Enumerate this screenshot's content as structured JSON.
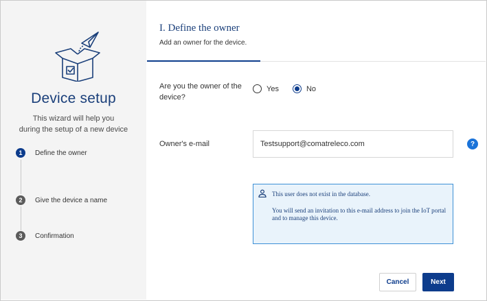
{
  "sidebar": {
    "hero_icon": "open-box-with-paper-plane-icon",
    "title": "Device setup",
    "subtitle_line1": "This wizard will help you",
    "subtitle_line2": "during the setup of a new device",
    "steps": [
      {
        "number": "1",
        "label": "Define the owner",
        "active": true
      },
      {
        "number": "2",
        "label": "Give the device a name",
        "active": false
      },
      {
        "number": "3",
        "label": "Confirmation",
        "active": false
      }
    ]
  },
  "header": {
    "title": "I. Define the owner",
    "subtitle": "Add an owner for the device."
  },
  "owner_question": {
    "label": "Are you the owner of the device?",
    "options": [
      {
        "label": "Yes",
        "checked": false
      },
      {
        "label": "No",
        "checked": true
      }
    ]
  },
  "email": {
    "label": "Owner's e-mail",
    "value": "Testsupport@comatreleco.com",
    "help": "?"
  },
  "info_box": {
    "icon": "user-icon",
    "title": "This user does not exist in the database.",
    "body": "You will send an invitation to this e-mail address to join the IoT portal and to manage this device."
  },
  "actions": {
    "cancel_label": "Cancel",
    "next_label": "Next"
  },
  "colors": {
    "brand": "#0d3c8c",
    "info_border": "#3b8fd6",
    "info_bg": "#e9f3fb",
    "help": "#1a73d9"
  }
}
